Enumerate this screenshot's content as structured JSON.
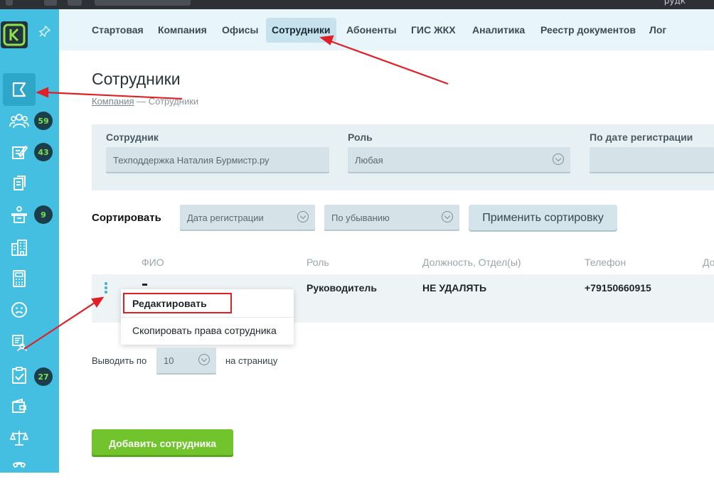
{
  "topbar": {
    "right_text": "рудк"
  },
  "sidebar": {
    "logo_letter": "К",
    "items": [
      {
        "icon": "flag-icon",
        "badge": ""
      },
      {
        "icon": "users-group-icon",
        "badge": "59"
      },
      {
        "icon": "edit-note-icon",
        "badge": "43"
      },
      {
        "icon": "documents-icon",
        "badge": ""
      },
      {
        "icon": "reception-icon",
        "badge": "9"
      },
      {
        "icon": "buildings-icon",
        "badge": ""
      },
      {
        "icon": "calculator-icon",
        "badge": ""
      },
      {
        "icon": "sad-face-icon",
        "badge": ""
      },
      {
        "icon": "employee-card-icon",
        "badge": ""
      },
      {
        "icon": "clipboard-check-icon",
        "badge": "27"
      },
      {
        "icon": "wallet-icon",
        "badge": ""
      },
      {
        "icon": "scales-icon",
        "badge": ""
      },
      {
        "icon": "phone-icon",
        "badge": ""
      }
    ]
  },
  "nav": {
    "items": [
      "Стартовая",
      "Компания",
      "Офисы",
      "Сотрудники",
      "Абоненты",
      "ГИС ЖКХ",
      "Аналитика",
      "Реестр документов",
      "Лог"
    ]
  },
  "page": {
    "title": "Сотрудники",
    "breadcrumb_link": "Компания",
    "breadcrumb_current": "— Сотрудники"
  },
  "filters": {
    "employee_label": "Сотрудник",
    "employee_value": "Техподдержка Наталия Бурмистр.ру",
    "role_label": "Роль",
    "role_value": "Любая",
    "date_label": "По дате регистрации",
    "date_value": ""
  },
  "sorting": {
    "label": "Сортировать",
    "field_value": "Дата регистрации",
    "order_value": "По убыванию",
    "apply_label": "Применить сортировку"
  },
  "table": {
    "headers": [
      "ФИО",
      "Роль",
      "Должность, Отдел(ы)",
      "Телефон",
      "До"
    ],
    "rows": [
      {
        "name": "",
        "role": "Руководитель",
        "position": "НЕ УДАЛЯТЬ",
        "phone": "+79150660915"
      }
    ]
  },
  "context_menu": {
    "items": [
      "Редактировать",
      "Скопировать права сотрудника"
    ]
  },
  "pagination": {
    "prefix": "Выводить по",
    "value": "10",
    "suffix": "на страницу"
  },
  "actions": {
    "add_label": "Добавить сотрудника"
  },
  "colors": {
    "sidebar": "#45bfe1",
    "nav_bg": "#e8f6fb",
    "accent_green": "#72c42c",
    "annotation_red": "#e01f26",
    "badge_bg": "#1b3e4a",
    "badge_text": "#7fe050"
  }
}
